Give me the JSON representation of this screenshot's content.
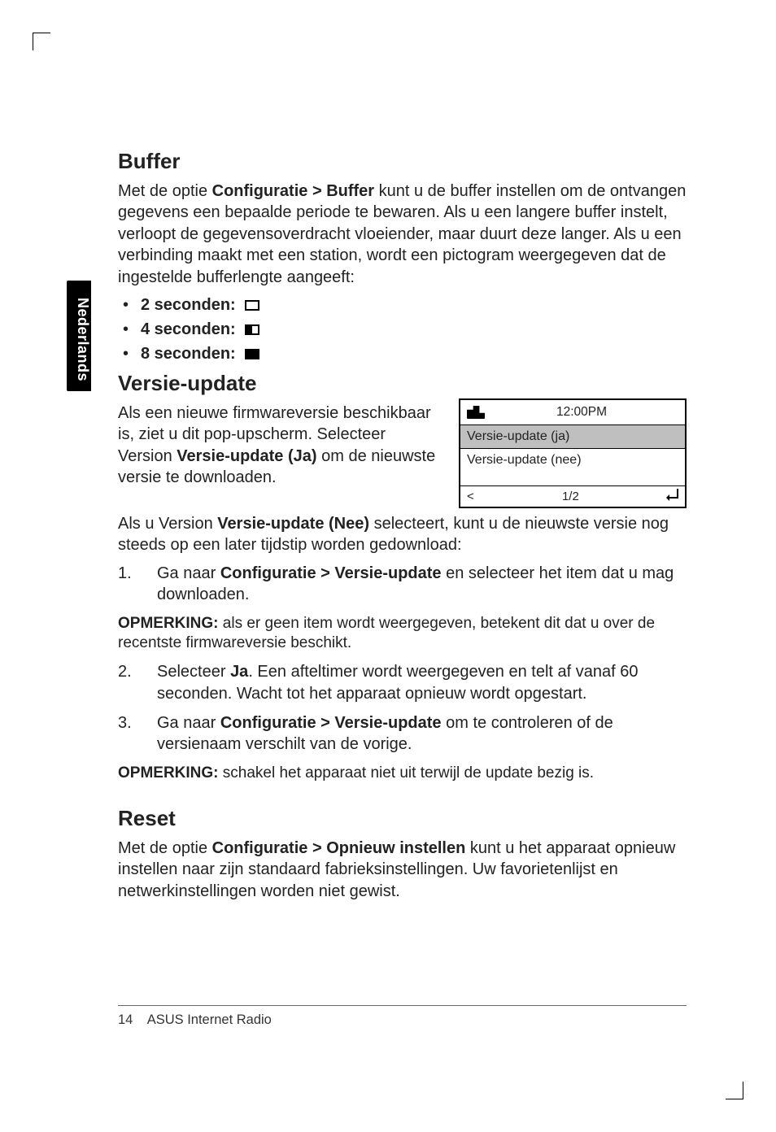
{
  "sidetab": "Nederlands",
  "buffer": {
    "heading": "Buffer",
    "intro_pre": "Met de optie ",
    "intro_bold": "Configuratie > Buffer",
    "intro_post": " kunt u de buffer instellen om de ontvangen gegevens een bepaalde periode te bewaren. Als u een langere buffer instelt, verloopt de gegevensoverdracht vloeiender, maar duurt deze langer. Als u een verbinding maakt met een station, wordt een pictogram weergegeven dat de ingestelde bufferlengte aangeeft:",
    "items": [
      "2 seconden:",
      "4 seconden:",
      "8 seconden:"
    ]
  },
  "version": {
    "heading": "Versie-update",
    "left_pre": "Als een nieuwe firmwareversie beschikbaar is, ziet u dit pop-upscherm. Selecteer Version ",
    "left_bold": "Versie-update (Ja)",
    "left_post": " om de nieuwste versie te downloaden.",
    "screen": {
      "time": "12:00PM",
      "row1": "Versie-update (ja)",
      "row2": "Versie-update (nee)",
      "left": "<",
      "page": "1/2"
    },
    "below_pre": "Als u Version ",
    "below_bold": "Versie-update (Nee)",
    "below_post": " selecteert, kunt u de nieuwste versie nog steeds op een later tijdstip worden gedownload:",
    "step1_pre": "Ga naar ",
    "step1_bold": "Configuratie > Versie-update",
    "step1_post": " en selecteer het item dat u mag downloaden.",
    "note1_bold": "OPMERKING:",
    "note1_post": " als er geen item wordt weergegeven, betekent dit dat u over de recentste firmwareversie beschikt.",
    "step2_pre": "Selecteer ",
    "step2_bold": "Ja",
    "step2_post": ". Een afteltimer wordt weergegeven en telt af vanaf 60 seconden. Wacht tot het apparaat opnieuw wordt opgestart.",
    "step3_pre": "Ga naar ",
    "step3_bold": "Configuratie > Versie-update",
    "step3_post": " om te controleren of de versienaam verschilt van de vorige.",
    "note2_bold": "OPMERKING:",
    "note2_post": " schakel het apparaat niet uit terwijl de update bezig is."
  },
  "reset": {
    "heading": "Reset",
    "pre": "Met de optie ",
    "bold": "Configuratie > Opnieuw instellen",
    "post": " kunt u het apparaat opnieuw instellen naar zijn standaard fabrieksinstellingen. Uw favorietenlijst en netwerkinstellingen worden niet gewist."
  },
  "footer": {
    "page": "14",
    "title": "ASUS Internet Radio"
  }
}
